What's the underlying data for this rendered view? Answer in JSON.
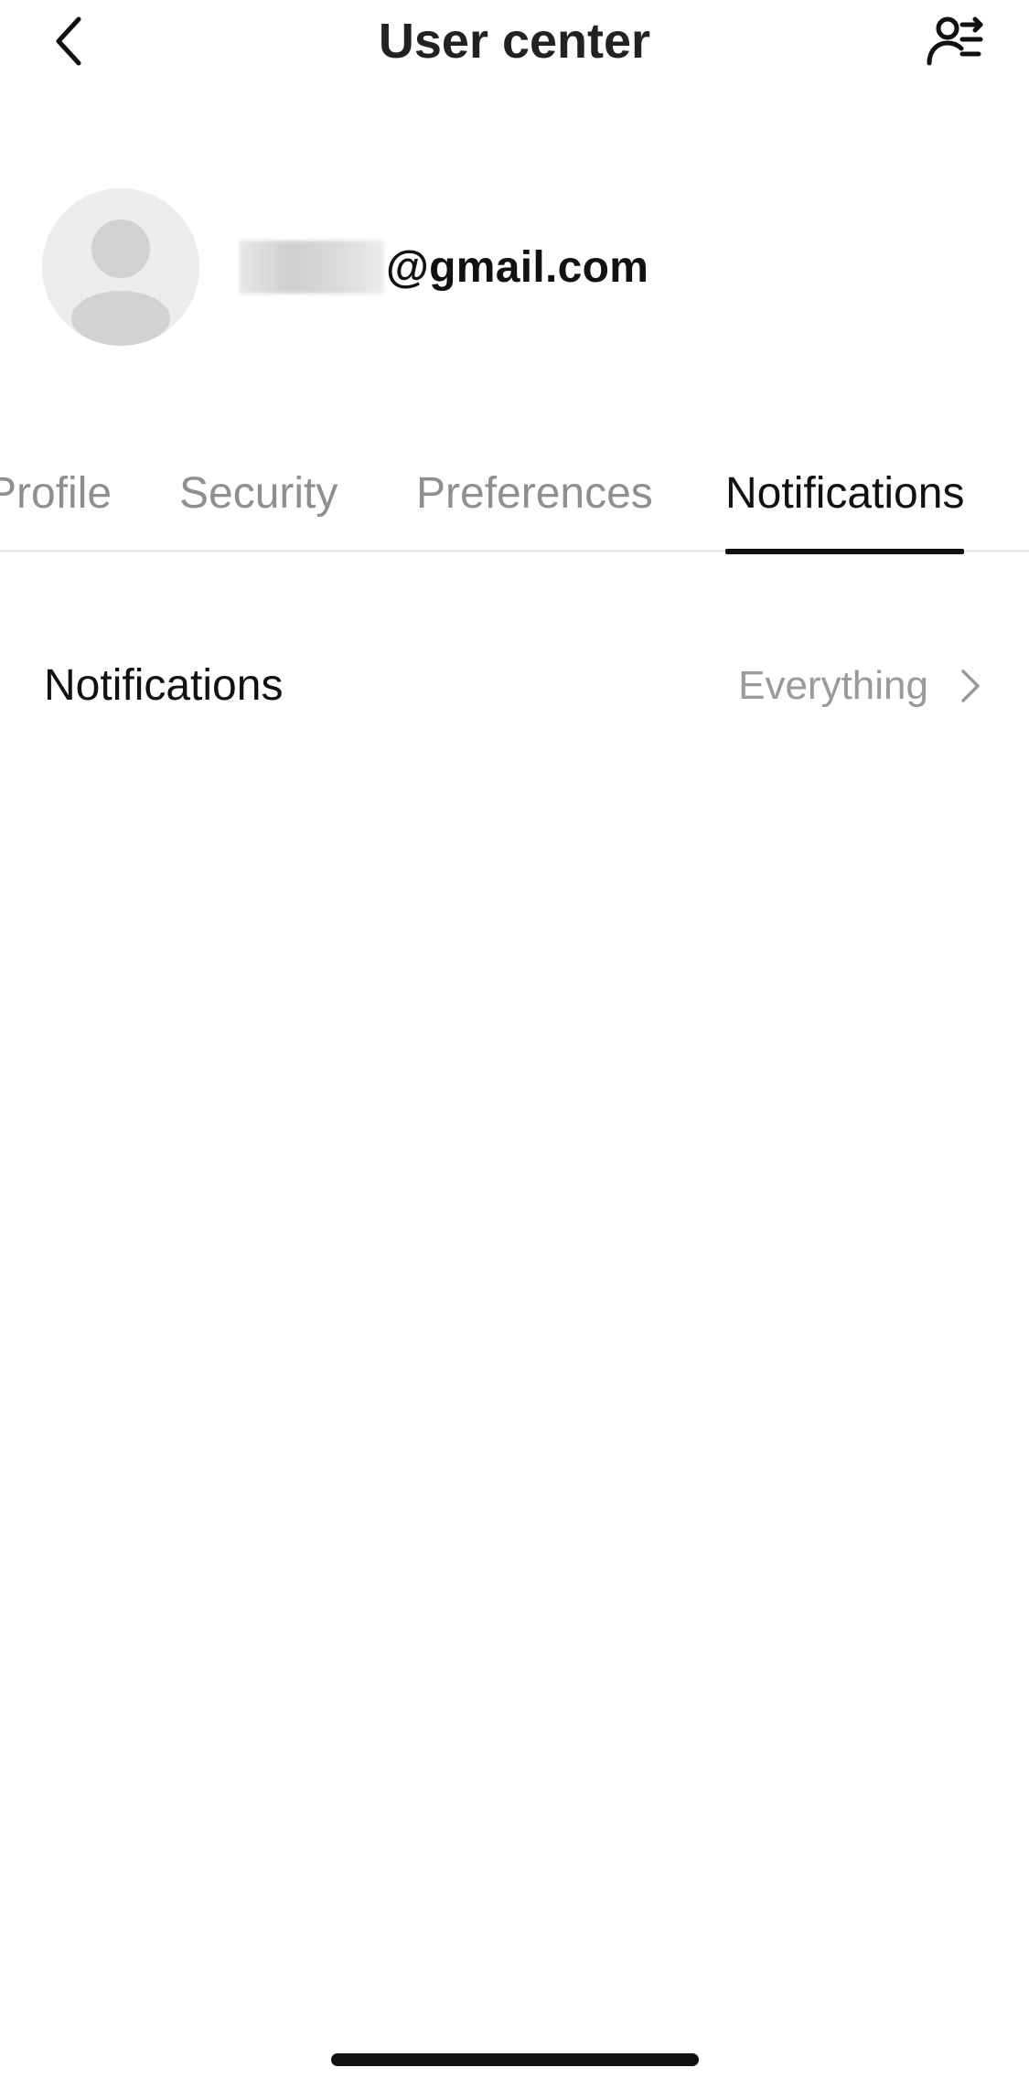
{
  "header": {
    "title": "User center",
    "back_icon": "chevron-left-icon",
    "switch_account_icon": "user-switch-icon"
  },
  "account": {
    "avatar_icon": "default-avatar-icon",
    "email_domain": "@gmail.com"
  },
  "tabs": [
    {
      "label": "Profile",
      "active": false
    },
    {
      "label": "Security",
      "active": false
    },
    {
      "label": "Preferences",
      "active": false
    },
    {
      "label": "Notifications",
      "active": true
    }
  ],
  "settings": {
    "notifications": {
      "label": "Notifications",
      "value": "Everything",
      "chevron_icon": "chevron-right-icon"
    }
  },
  "colors": {
    "text_primary": "#111111",
    "text_secondary": "#8f8f8f",
    "avatar_bg": "#ececec",
    "divider": "#ececec"
  }
}
